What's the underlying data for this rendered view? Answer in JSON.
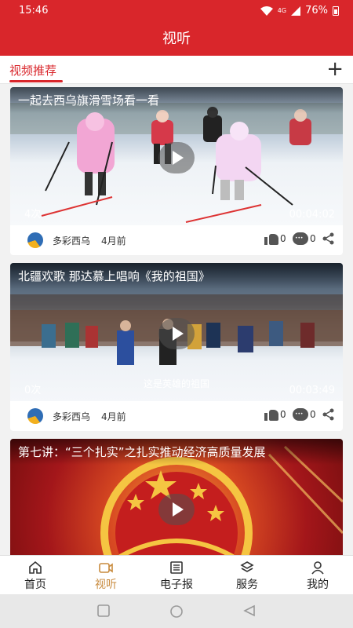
{
  "status_bar": {
    "time": "15:46",
    "network": "4G",
    "battery": "76%"
  },
  "header": {
    "title": "视听"
  },
  "tabs": {
    "active": "视频推荐"
  },
  "videos": [
    {
      "title": "一起去西乌旗滑雪场看一看",
      "views": "4次",
      "duration": "00:04:02",
      "source": "多彩西乌",
      "ago": "4月前",
      "likes": "0",
      "comments": "0",
      "caption": ""
    },
    {
      "title": "北疆欢歌 那达慕上唱响《我的祖国》",
      "views": "0次",
      "duration": "00:03:49",
      "source": "多彩西乌",
      "ago": "4月前",
      "likes": "0",
      "comments": "0",
      "caption": "这是英雄的祖国"
    },
    {
      "title": "第七讲：“三个扎实”之扎实推动经济高质量发展",
      "views": "",
      "duration": "",
      "source": "",
      "ago": "",
      "likes": "",
      "comments": "",
      "caption": ""
    }
  ],
  "nav": [
    "首页",
    "视听",
    "电子报",
    "服务",
    "我的"
  ],
  "colors": {
    "brand": "#d9262b",
    "nav_active": "#c88a3c"
  }
}
